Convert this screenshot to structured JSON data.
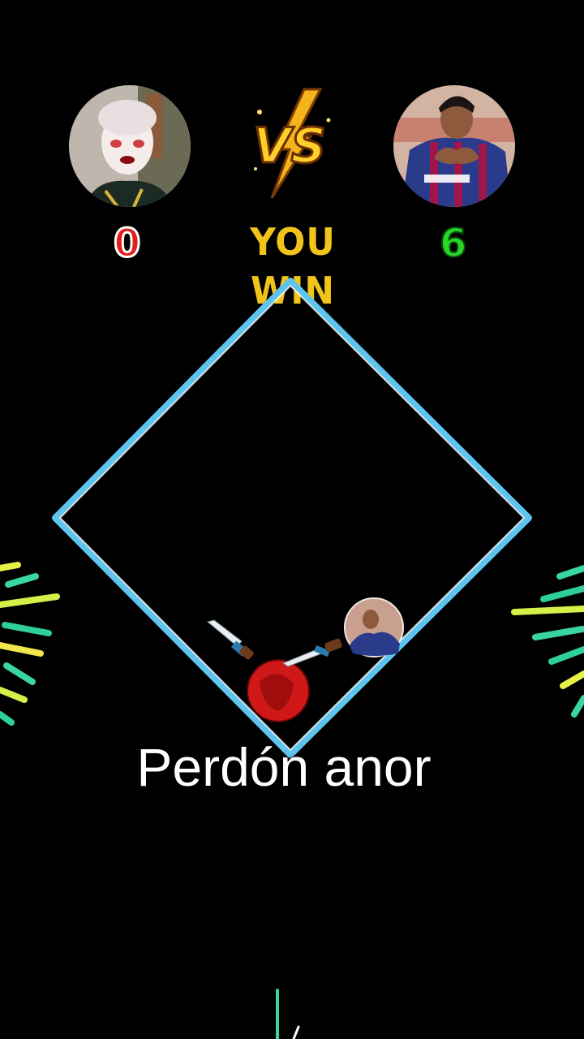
{
  "players": {
    "left": {
      "score": "0"
    },
    "right": {
      "score": "6"
    }
  },
  "vs_badge": {
    "label": "VS"
  },
  "result": {
    "text": "YOU WIN"
  },
  "caption": {
    "text": "Perdón anor"
  },
  "colors": {
    "arena_border": "#5ec4ee",
    "left_score": "#e21f1f",
    "right_score": "#28d628",
    "result_text": "#f1c419",
    "vs_gold": "#f4b51c",
    "left_ball": "#d01818"
  },
  "icons": [
    "vs-lightning-icon",
    "knife-icon",
    "firework-icon"
  ]
}
